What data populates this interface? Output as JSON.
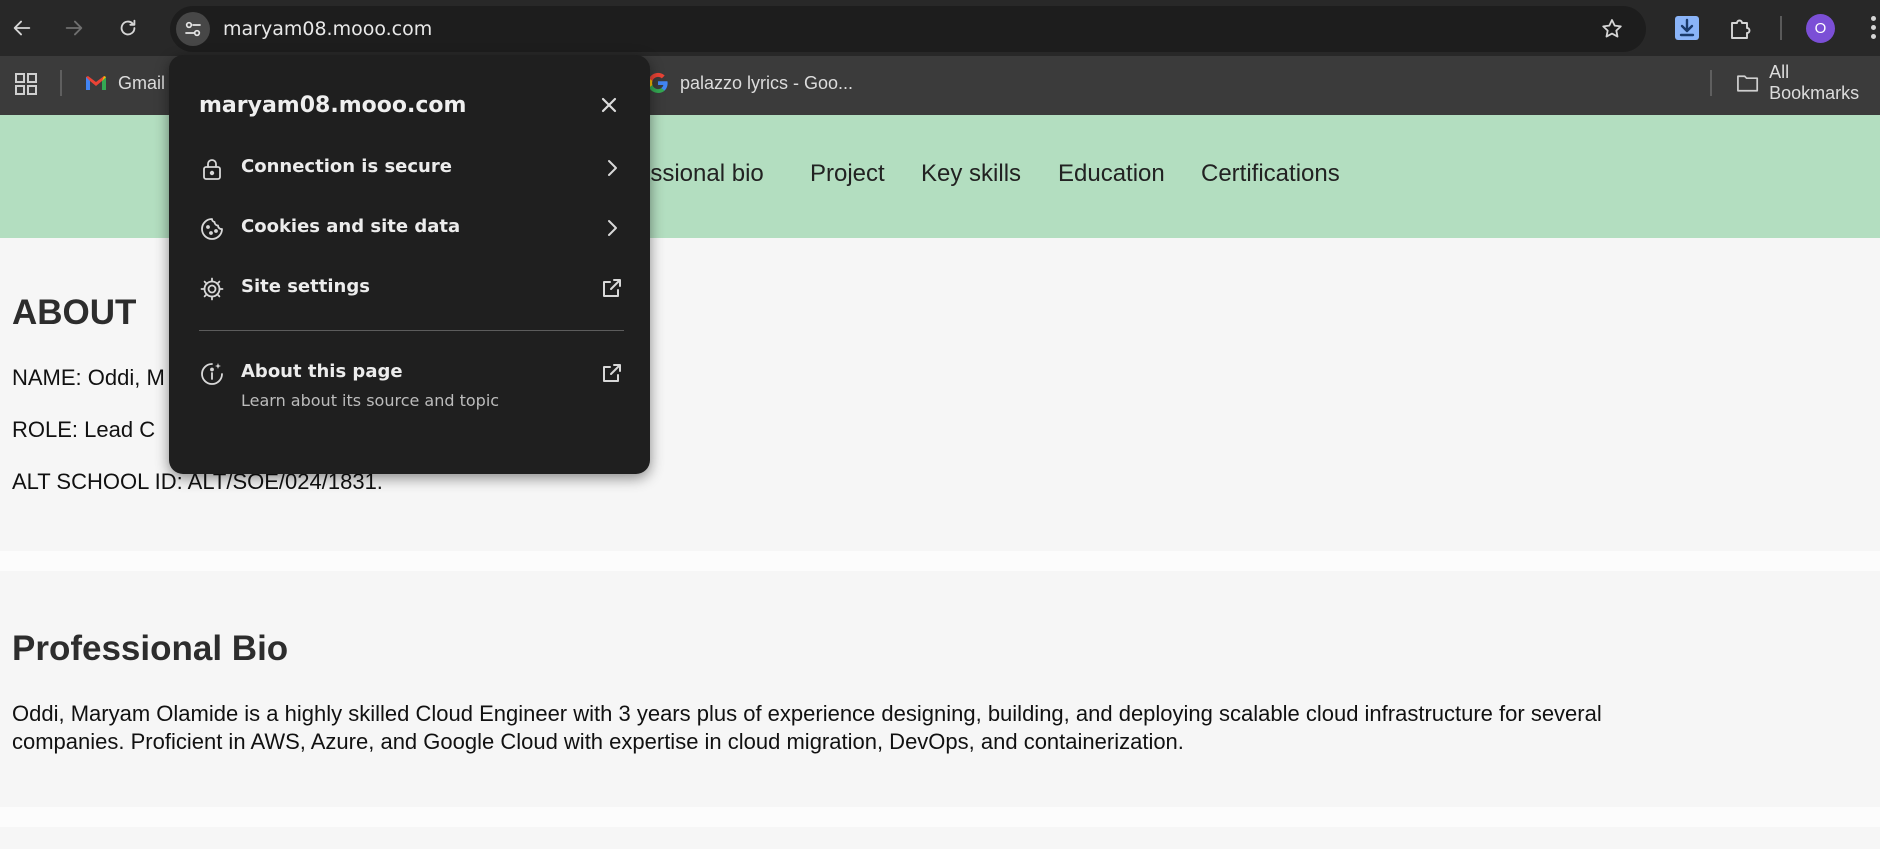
{
  "browser": {
    "url": "maryam08.mooo.com",
    "avatar_initial": "O",
    "bookmarks": [
      {
        "label": "Gmail",
        "icon": "gmail-icon"
      },
      {
        "label": "palazzo lyrics - Goo...",
        "icon": "google-icon"
      }
    ],
    "all_bookmarks": "All Bookmarks"
  },
  "site_info_popup": {
    "title": "maryam08.mooo.com",
    "rows": [
      {
        "label": "Connection is secure",
        "icon": "lock-icon"
      },
      {
        "label": "Cookies and site data",
        "icon": "cookie-icon"
      },
      {
        "label": "Site settings",
        "icon": "gear-icon"
      },
      {
        "label": "About this page",
        "sublabel": "Learn about its source and topic",
        "icon": "info-icon"
      }
    ]
  },
  "site_nav": {
    "links": [
      "essional bio",
      "Project",
      "Key skills",
      "Education",
      "Certifications"
    ]
  },
  "about": {
    "heading": "ABOUT",
    "name_line": "NAME: Oddi, M",
    "role_line": "ROLE: Lead C",
    "id_line": "ALT SCHOOL ID: ALT/SOE/024/1831."
  },
  "bio": {
    "heading": "Professional Bio",
    "line1": "Oddi, Maryam Olamide is a highly skilled Cloud Engineer with 3 years plus of experience designing, building, and deploying scalable cloud infrastructure for several",
    "line2": "companies. Proficient in AWS, Azure, and Google Cloud with expertise in cloud migration, DevOps, and containerization."
  },
  "colors": {
    "nav_background": "#b3dec0",
    "popup_background": "#1f1f1f",
    "toolbar_background": "#282828"
  }
}
